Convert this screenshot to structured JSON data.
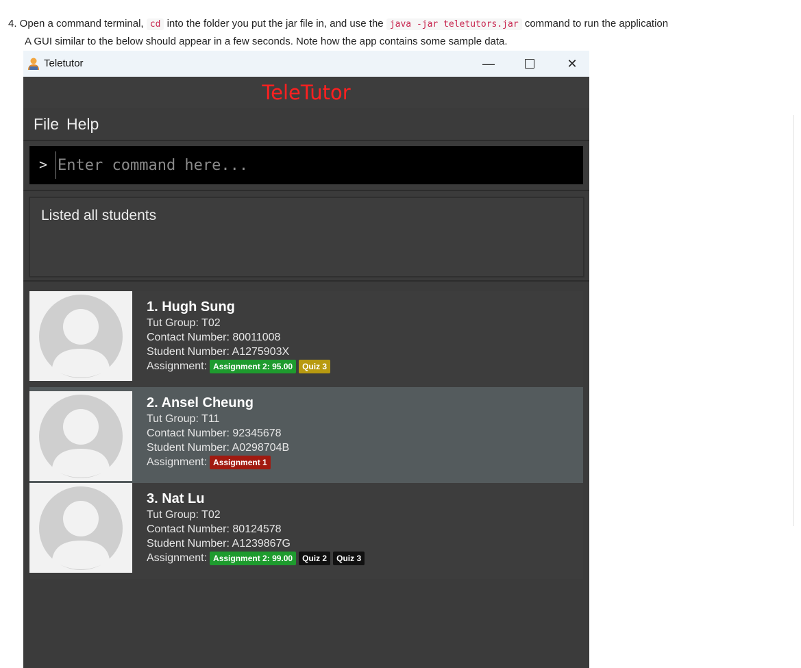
{
  "doc": {
    "line1_prefix": "4. Open a command terminal,",
    "line1_code1": "cd",
    "line1_mid": "into the folder you put the jar file in, and use the",
    "line1_code2": "java -jar teletutors.jar",
    "line1_suffix": "command to run the application",
    "line2": "A GUI similar to the below should appear in a few seconds. Note how the app contains some sample data."
  },
  "window": {
    "title": "Teletutor",
    "minimize_glyph": "—",
    "close_glyph": "✕"
  },
  "app": {
    "header": "TeleTutor",
    "menu": [
      "File",
      "Help"
    ],
    "command": {
      "prompt": ">",
      "placeholder": "Enter command here...",
      "value": ""
    },
    "result": "Listed all students"
  },
  "labels": {
    "tut_group": "Tut Group:",
    "contact": "Contact Number:",
    "student_no": "Student Number:",
    "assignment": "Assignment:"
  },
  "colors": {
    "tag_green": "#1e9b2e",
    "tag_yellow": "#b89a10",
    "tag_red": "#a11a10",
    "tag_black": "#111111",
    "header_red": "#ff2020"
  },
  "students": [
    {
      "name": "1. Hugh Sung",
      "tut_group": "T02",
      "contact": "80011008",
      "student_no": "A1275903X",
      "tags": [
        {
          "label": "Assignment 2: 95.00",
          "color": "green"
        },
        {
          "label": "Quiz 3",
          "color": "yellow"
        }
      ]
    },
    {
      "name": "2. Ansel Cheung",
      "tut_group": "T11",
      "contact": "92345678",
      "student_no": "A0298704B",
      "tags": [
        {
          "label": "Assignment 1",
          "color": "red"
        }
      ]
    },
    {
      "name": "3. Nat Lu",
      "tut_group": "T02",
      "contact": "80124578",
      "student_no": "A1239867G",
      "tags": [
        {
          "label": "Assignment 2: 99.00",
          "color": "green"
        },
        {
          "label": "Quiz 2",
          "color": "black"
        },
        {
          "label": "Quiz 3",
          "color": "black"
        }
      ]
    }
  ]
}
